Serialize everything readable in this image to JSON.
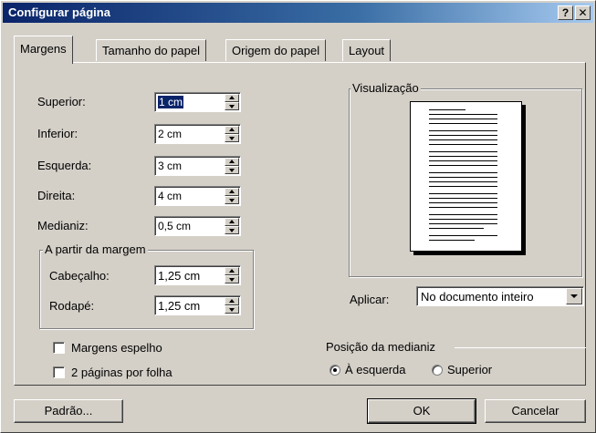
{
  "window": {
    "title": "Configurar página",
    "help_button": "?",
    "close_button": "✕"
  },
  "tabs": [
    {
      "label": "Margens",
      "active": true
    },
    {
      "label": "Tamanho do papel",
      "active": false
    },
    {
      "label": "Origem do papel",
      "active": false
    },
    {
      "label": "Layout",
      "active": false
    }
  ],
  "margins": {
    "superior": {
      "label": "Superior:",
      "value": "1 cm"
    },
    "inferior": {
      "label": "Inferior:",
      "value": "2 cm"
    },
    "esquerda": {
      "label": "Esquerda:",
      "value": "3 cm"
    },
    "direita": {
      "label": "Direita:",
      "value": "4 cm"
    },
    "medianiz": {
      "label": "Medianiz:",
      "value": "0,5 cm"
    }
  },
  "from_edge": {
    "title": "A partir da margem",
    "cabecalho": {
      "label": "Cabeçalho:",
      "value": "1,25 cm"
    },
    "rodape": {
      "label": "Rodapé:",
      "value": "1,25 cm"
    }
  },
  "checkboxes": {
    "mirror": {
      "label": "Margens espelho",
      "checked": false
    },
    "two_pages": {
      "label": "2 páginas por folha",
      "checked": false
    }
  },
  "preview": {
    "title": "Visualização"
  },
  "apply": {
    "label": "Aplicar:",
    "value": "No documento inteiro"
  },
  "gutter_position": {
    "title": "Posição da medianiz",
    "left": {
      "label": "À esquerda",
      "checked": true
    },
    "top": {
      "label": "Superior",
      "checked": false
    }
  },
  "buttons": {
    "default": "Padrão...",
    "ok": "OK",
    "cancel": "Cancelar"
  }
}
